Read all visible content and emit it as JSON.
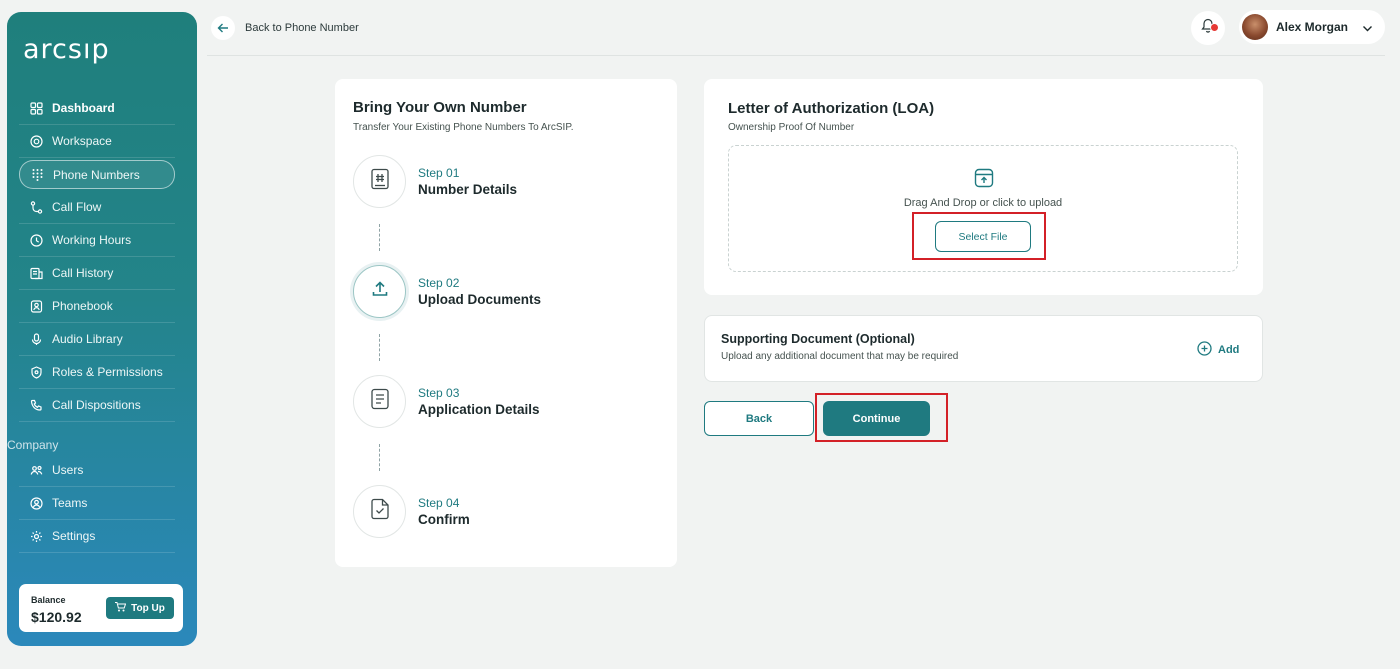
{
  "sidebar": {
    "logo": "arcsıp",
    "items": [
      {
        "label": "Dashboard",
        "icon": "dashboard-grid-icon"
      },
      {
        "label": "Workspace",
        "icon": "workspace-icon"
      },
      {
        "label": "Phone Numbers",
        "icon": "dialpad-icon"
      },
      {
        "label": "Call Flow",
        "icon": "flow-icon"
      },
      {
        "label": "Working Hours",
        "icon": "clock-icon"
      },
      {
        "label": "Call History",
        "icon": "history-icon"
      },
      {
        "label": "Phonebook",
        "icon": "contact-book-icon"
      },
      {
        "label": "Audio Library",
        "icon": "microphone-icon"
      },
      {
        "label": "Roles & Permissions",
        "icon": "shield-icon"
      },
      {
        "label": "Call Dispositions",
        "icon": "phone-icon"
      }
    ],
    "company_label": "Company",
    "company_items": [
      {
        "label": "Users",
        "icon": "users-icon"
      },
      {
        "label": "Teams",
        "icon": "team-icon"
      },
      {
        "label": "Settings",
        "icon": "gear-icon"
      }
    ],
    "balance_label": "Balance",
    "balance_value": "$120.92",
    "topup_label": "Top Up"
  },
  "topbar": {
    "back_label": "Back to Phone Number",
    "user_name": "Alex Morgan"
  },
  "steps": {
    "title": "Bring Your Own Number",
    "subtitle": "Transfer Your Existing Phone Numbers To ArcSIP.",
    "items": [
      {
        "num": "Step 01",
        "name": "Number Details"
      },
      {
        "num": "Step 02",
        "name": "Upload Documents"
      },
      {
        "num": "Step 03",
        "name": "Application Details"
      },
      {
        "num": "Step 04",
        "name": "Confirm"
      }
    ],
    "current_step": 2
  },
  "loa": {
    "title": "Letter of Authorization (LOA)",
    "subtitle": "Ownership Proof Of Number",
    "drop_text": "Drag And Drop or click to upload",
    "select_label": "Select File"
  },
  "supporting": {
    "title": "Supporting Document (Optional)",
    "subtitle": "Upload any additional document that may be required",
    "add_label": "Add"
  },
  "actions": {
    "back_label": "Back",
    "continue_label": "Continue"
  },
  "colors": {
    "accent": "#1f7a80",
    "highlight": "#d32027"
  }
}
